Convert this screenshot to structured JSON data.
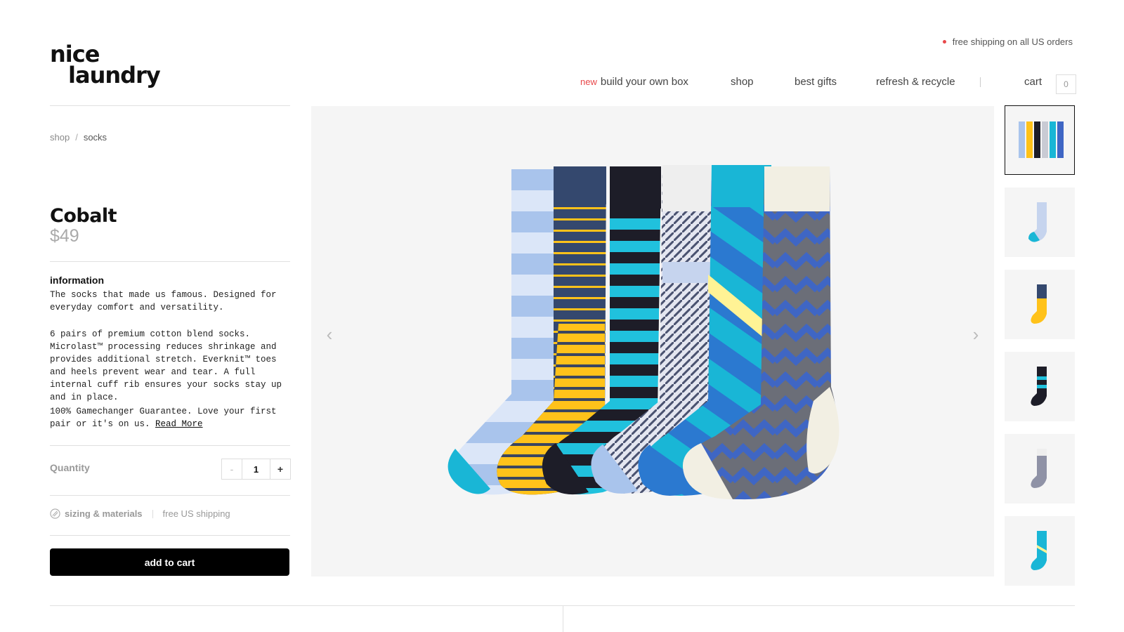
{
  "brand": {
    "line1": "nice",
    "line2": "laundry"
  },
  "promo": {
    "text": "free shipping on all US orders",
    "dot_color": "#e8484a"
  },
  "nav": {
    "new_badge": "new",
    "items": [
      "build your own box",
      "shop",
      "best gifts",
      "refresh & recycle"
    ],
    "cart_label": "cart",
    "cart_count": "0"
  },
  "breadcrumb": {
    "items": [
      "shop",
      "socks"
    ],
    "separator": "/"
  },
  "product": {
    "name": "Cobalt",
    "price": "$49",
    "info_heading": "information",
    "desc1": "The socks that made us famous. Designed for everyday comfort and versatility.",
    "desc2": "6 pairs of premium cotton blend socks. Microlast™ processing reduces shrinkage and provides additional stretch. Everknit™ toes and heels prevent wear and tear. A full internal cuff rib ensures your socks stay up and in place.",
    "desc3": "100% Gamechanger Guarantee. Love your first pair or it's on us.",
    "read_more": "Read More"
  },
  "quantity": {
    "label": "Quantity",
    "value": "1",
    "minus": "-",
    "plus": "+"
  },
  "sizing": {
    "label": "sizing & materials",
    "shipping": "free US shipping"
  },
  "add_to_cart": "add to cart",
  "gallery": {
    "prev_icon": "chevron-left-icon",
    "next_icon": "chevron-right-icon",
    "sock_colors": [
      "#a9c4ec",
      "#34486e",
      "#1d1d28",
      "#e9e9ea",
      "#19b6d6",
      "#3f66c4"
    ],
    "accent_colors": [
      "#ffc21a",
      "#20c1dd",
      "#fff395"
    ],
    "thumbnails": [
      "all six socks",
      "light blue stripe sock",
      "yellow stripe sock",
      "black cyan stripe sock",
      "grey herringbone sock",
      "cyan diagonal sock"
    ]
  }
}
